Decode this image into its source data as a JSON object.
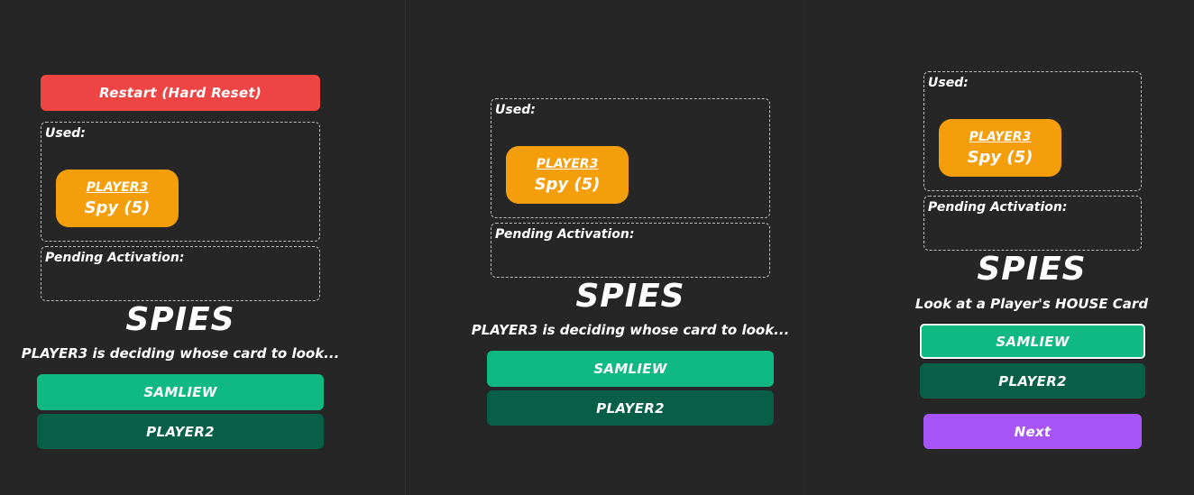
{
  "panels": [
    {
      "restart_label": "Restart (Hard Reset)",
      "used_label": "Used:",
      "used_card": {
        "player": "PLAYER3",
        "role": "Spy (5)"
      },
      "pending_label": "Pending Activation:",
      "title": "SPIES",
      "subtitle": "PLAYER3 is deciding whose card to look...",
      "players": [
        "SAMLIEW",
        "PLAYER2"
      ]
    },
    {
      "used_label": "Used:",
      "used_card": {
        "player": "PLAYER3",
        "role": "Spy (5)"
      },
      "pending_label": "Pending Activation:",
      "title": "SPIES",
      "subtitle": "PLAYER3 is deciding whose card to look...",
      "players": [
        "SAMLIEW",
        "PLAYER2"
      ]
    },
    {
      "used_label": "Used:",
      "used_card": {
        "player": "PLAYER3",
        "role": "Spy (5)"
      },
      "pending_label": "Pending Activation:",
      "title": "SPIES",
      "subtitle": "Look at a Player's HOUSE Card",
      "players": [
        "SAMLIEW",
        "PLAYER2"
      ],
      "next_label": "Next"
    }
  ],
  "colors": {
    "background": "#262626",
    "restart": "#ef4444",
    "player_primary": "#10b981",
    "player_secondary": "#065f46",
    "card": "#f59e0b",
    "next": "#a855f7"
  }
}
